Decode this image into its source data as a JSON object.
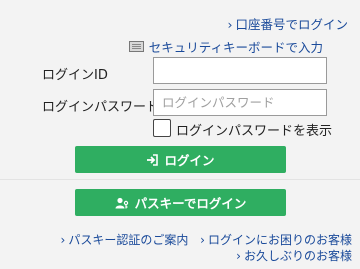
{
  "links": {
    "account_login": "口座番号でログイン",
    "security_keyboard": "セキュリティキーボードで入力",
    "passkey_auth": "パスキー認証のご案内",
    "login_trouble": "ログインにお困りのお客様",
    "long_absence": "お久しぶりのお客様"
  },
  "form": {
    "login_id_label": "ログインID",
    "login_id_value": "",
    "password_label": "ログインパスワード",
    "password_placeholder": "ログインパスワード",
    "show_password_label": "ログインパスワードを表示"
  },
  "buttons": {
    "login": "ログイン",
    "passkey_login": "パスキーでログイン"
  },
  "icons": {
    "chevron": "chevron-right-icon",
    "keyboard": "keyboard-icon",
    "login": "login-arrow-icon",
    "passkey": "passkey-user-icon"
  },
  "colors": {
    "accent_green": "#2fae61",
    "link_blue": "#1a4a9a",
    "background": "#f3f3f3"
  }
}
